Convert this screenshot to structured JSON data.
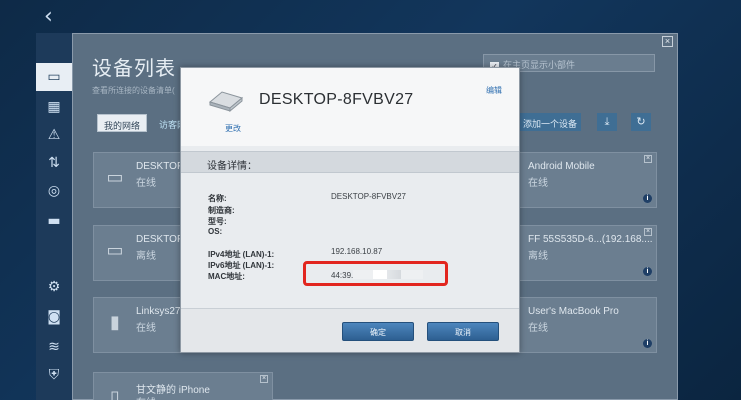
{
  "panel": {
    "title": "设备列表",
    "subtitle": "查看所连接的设备清单(",
    "close": "×",
    "show_widget_label": "在主页显示小部件",
    "tabs": [
      "我的网络",
      "访客网"
    ],
    "add_device_label": "添加一个设备"
  },
  "cards": [
    {
      "name": "DESKTOP",
      "status": "在线"
    },
    {
      "name": "DESKTOP",
      "status": "离线"
    },
    {
      "name": "Linksys27",
      "status": "在线"
    },
    {
      "name": "甘文静的 iPhone",
      "status": "在线"
    },
    {
      "name": "Android Mobile",
      "status": "在线"
    },
    {
      "name": "FF 55S535D-6...(192.168....",
      "status": "离线"
    },
    {
      "name": "User's MacBook Pro",
      "status": "在线"
    }
  ],
  "dialog": {
    "hostname": "DESKTOP-8FVBV27",
    "change_label": "更改",
    "edit_label": "编辑",
    "section_title": "设备详情：",
    "fields": [
      {
        "label": "名称:",
        "value": "DESKTOP-8FVBV27"
      },
      {
        "label": "制造商:",
        "value": ""
      },
      {
        "label": "型号:",
        "value": ""
      },
      {
        "label": "OS:",
        "value": ""
      },
      {
        "label": "IPv4地址 (LAN)-1:",
        "value": "192.168.10.87"
      },
      {
        "label": "IPv6地址 (LAN)-1:",
        "value": ""
      },
      {
        "label": "MAC地址:",
        "value": "44:39."
      }
    ],
    "ok_label": "确定",
    "cancel_label": "取消"
  },
  "colors": {
    "highlight": "#e2261f",
    "primary_button": "#2d5f91",
    "link": "#2f6fb0"
  }
}
